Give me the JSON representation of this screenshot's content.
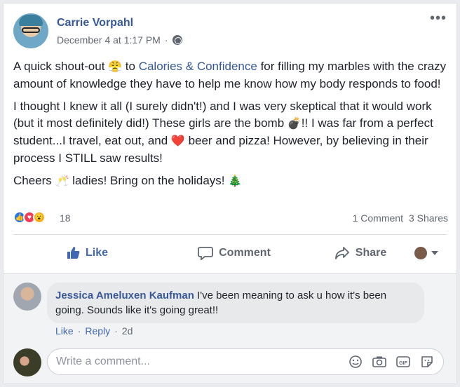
{
  "post": {
    "author": "Carrie Vorpahl",
    "timestamp": "December 4 at 1:17 PM",
    "meta_separator": "·",
    "body": {
      "p1": {
        "part1": "A quick shout-out ",
        "emoji1": "😤",
        "part2": " to ",
        "link": "Calories & Confidence",
        "part3": " for filling my marbles with the crazy amount of knowledge they have to help me know how my body responds to food!"
      },
      "p2": {
        "part1": "I thought I knew it all (I surely didn't!) and I was very skeptical that it would work (but it most definitely did!) These girls are the bomb ",
        "emoji_bomb": "💣",
        "part2": "!! I was far from a perfect student...I travel, eat out, and ",
        "emoji_heart": "❤️",
        "part3": " beer and pizza! However, by believing in their process I STILL saw results!"
      },
      "p3": {
        "part1": "Cheers ",
        "emoji_cheers": "🥂",
        "part2": " ladies! Bring on the holidays! ",
        "emoji_tree": "🎄"
      }
    },
    "reactions": {
      "count": "18",
      "like_glyph": "👍",
      "love_glyph": "♥",
      "wow_glyph": "😮"
    },
    "engagement": {
      "comments": "1 Comment",
      "shares": "3 Shares"
    },
    "more_glyph": "•••"
  },
  "actions": {
    "like_label": "Like",
    "comment_label": "Comment",
    "share_label": "Share"
  },
  "comments": [
    {
      "author": "Jessica Ameluxen Kaufman",
      "text": " I've been meaning to ask u how it's been going. Sounds like it's going great!!",
      "like_label": "Like",
      "reply_label": "Reply",
      "separator": "·",
      "time": "2d"
    }
  ],
  "composer": {
    "placeholder": "Write a comment..."
  },
  "colors": {
    "link": "#365899",
    "like_active": "#4267b2"
  },
  "icons": [
    "more-options-icon",
    "globe-icon",
    "like-icon",
    "comment-icon",
    "share-icon",
    "emoji-icon",
    "camera-icon",
    "gif-icon",
    "sticker-icon"
  ]
}
